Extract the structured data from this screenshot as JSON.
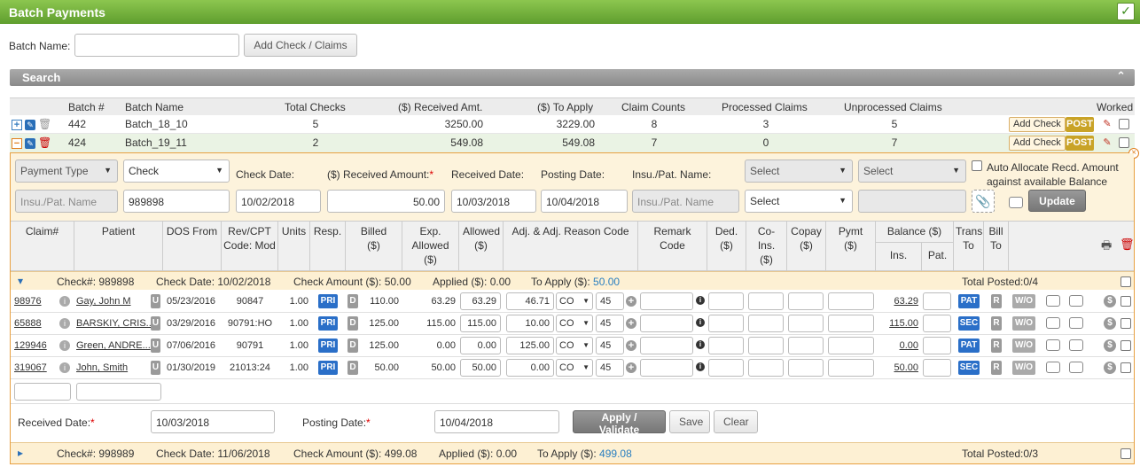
{
  "header": {
    "title": "Batch Payments",
    "icon": "clipboard-check-icon"
  },
  "batch": {
    "name_label": "Batch Name:",
    "name_value": "",
    "add_button": "Add Check / Claims"
  },
  "search": {
    "title": "Search"
  },
  "batch_table": {
    "columns": [
      "Batch #",
      "Batch Name",
      "Total Checks",
      "($) Received Amt.",
      "($) To Apply",
      "Claim Counts",
      "Processed Claims",
      "Unprocessed Claims",
      "Worked"
    ],
    "rows": [
      {
        "batch_no": "442",
        "name": "Batch_18_10",
        "checks": "5",
        "received": "3250.00",
        "to_apply": "3229.00",
        "claims": "8",
        "processed": "3",
        "unprocessed": "5"
      },
      {
        "batch_no": "424",
        "name": "Batch_19_11",
        "checks": "2",
        "received": "549.08",
        "to_apply": "549.08",
        "claims": "7",
        "processed": "0",
        "unprocessed": "7"
      }
    ],
    "add_check": "Add Check",
    "post": "POST"
  },
  "payment": {
    "payment_type": "Payment Type",
    "method": "Check",
    "check_date_label": "Check Date:",
    "received_amount_label": "($) Received Amount:",
    "required": "*",
    "received_date_label": "Received Date:",
    "posting_date_label": "Posting Date:",
    "insu_label": "Insu./Pat. Name:",
    "select1": "Select",
    "select2": "Select",
    "auto_allocate": "Auto Allocate Recd. Amount against available Balance",
    "insu_placeholder": "Insu./Pat. Name",
    "check_no": "989898",
    "check_date": "10/02/2018",
    "received_amount": "50.00",
    "received_date": "10/03/2018",
    "posting_date": "10/04/2018",
    "insu_placeholder2": "Insu./Pat. Name",
    "select3": "Select",
    "update": "Update"
  },
  "grid": {
    "headers": {
      "claim": "Claim#",
      "patient": "Patient",
      "dos": "DOS From",
      "cpt": "Rev/CPT Code: Mod",
      "units": "Units",
      "resp": "Resp.",
      "billed": "Billed ($)",
      "exp": "Exp. Allowed ($)",
      "allowed": "Allowed ($)",
      "adj": "Adj. & Adj. Reason Code",
      "remark": "Remark Code",
      "ded": "Ded. ($)",
      "coins": "Co-Ins. ($)",
      "copay": "Copay ($)",
      "pymt": "Pymt ($)",
      "balance": "Balance ($)",
      "ins": "Ins.",
      "pat": "Pat.",
      "trans": "Trans To",
      "bill": "Bill To"
    },
    "check1": {
      "check_no": "Check#: 989898",
      "check_date": "Check Date: 10/02/2018",
      "amount": "Check Amount ($): 50.00",
      "applied": "Applied ($): 0.00",
      "to_apply_label": "To Apply ($):",
      "to_apply_value": "50.00",
      "posted": "Total Posted:0/4"
    },
    "claims": [
      {
        "claim": "98976",
        "patient": "Gay, John M",
        "dos": "05/23/2016",
        "cpt": "90847",
        "units": "1.00",
        "resp": "PRI",
        "billed": "110.00",
        "exp": "63.29",
        "allowed": "63.29",
        "adj": "46.71",
        "code": "CO",
        "reason": "45",
        "balance": "63.29",
        "trans": "PAT"
      },
      {
        "claim": "65888",
        "patient": "BARSKIY, CRIS...",
        "dos": "03/29/2016",
        "cpt": "90791:HO",
        "units": "1.00",
        "resp": "PRI",
        "billed": "125.00",
        "exp": "115.00",
        "allowed": "115.00",
        "adj": "10.00",
        "code": "CO",
        "reason": "45",
        "balance": "115.00",
        "trans": "SEC"
      },
      {
        "claim": "129946",
        "patient": "Green, ANDRE...",
        "dos": "07/06/2016",
        "cpt": "90791",
        "units": "1.00",
        "resp": "PRI",
        "billed": "125.00",
        "exp": "0.00",
        "allowed": "0.00",
        "adj": "125.00",
        "code": "CO",
        "reason": "45",
        "balance": "0.00",
        "trans": "PAT"
      },
      {
        "claim": "319067",
        "patient": "John, Smith",
        "dos": "01/30/2019",
        "cpt": "21013:24",
        "units": "1.00",
        "resp": "PRI",
        "billed": "50.00",
        "exp": "50.00",
        "allowed": "50.00",
        "adj": "0.00",
        "code": "CO",
        "reason": "45",
        "balance": "50.00",
        "trans": "SEC"
      }
    ],
    "tags": {
      "u": "U",
      "d": "D",
      "r": "R",
      "wo": "W/O"
    },
    "footer": {
      "received_date_label": "Received Date:",
      "received_date": "10/03/2018",
      "posting_date_label": "Posting Date:",
      "posting_date": "10/04/2018",
      "apply": "Apply / Validate",
      "save": "Save",
      "clear": "Clear"
    },
    "check2": {
      "check_no": "Check#: 998989",
      "check_date": "Check Date: 11/06/2018",
      "amount": "Check Amount ($): 499.08",
      "applied": "Applied ($): 0.00",
      "to_apply_label": "To Apply ($):",
      "to_apply_value": "499.08",
      "posted": "Total Posted:0/3"
    }
  }
}
